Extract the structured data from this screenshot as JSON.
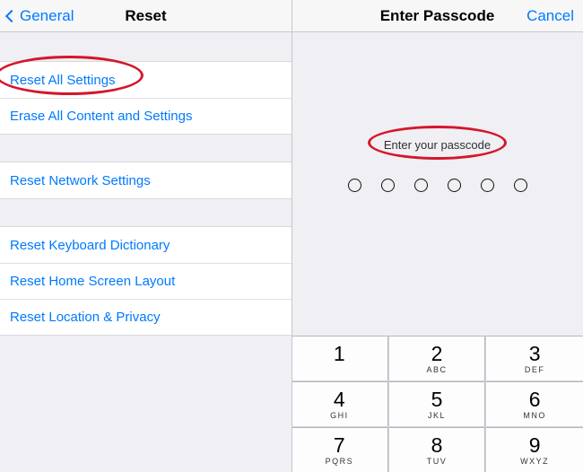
{
  "left": {
    "back_label": "General",
    "title": "Reset",
    "group1": {
      "items": [
        {
          "label": "Reset All Settings"
        },
        {
          "label": "Erase All Content and Settings"
        }
      ]
    },
    "group2": {
      "items": [
        {
          "label": "Reset Network Settings"
        }
      ]
    },
    "group3": {
      "items": [
        {
          "label": "Reset Keyboard Dictionary"
        },
        {
          "label": "Reset Home Screen Layout"
        },
        {
          "label": "Reset Location & Privacy"
        }
      ]
    }
  },
  "right": {
    "title": "Enter Passcode",
    "cancel": "Cancel",
    "prompt": "Enter your passcode",
    "passcode_length": 6,
    "keypad": [
      {
        "d": "1",
        "l": ""
      },
      {
        "d": "2",
        "l": "ABC"
      },
      {
        "d": "3",
        "l": "DEF"
      },
      {
        "d": "4",
        "l": "GHI"
      },
      {
        "d": "5",
        "l": "JKL"
      },
      {
        "d": "6",
        "l": "MNO"
      },
      {
        "d": "7",
        "l": "PQRS"
      },
      {
        "d": "8",
        "l": "TUV"
      },
      {
        "d": "9",
        "l": "WXYZ"
      }
    ]
  },
  "colors": {
    "link": "#007aff",
    "highlight": "#d4162a"
  }
}
